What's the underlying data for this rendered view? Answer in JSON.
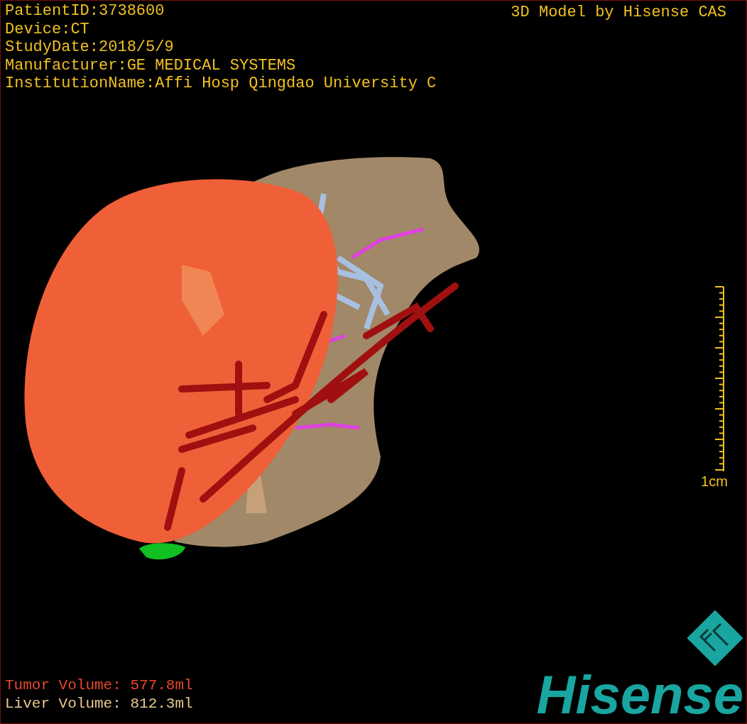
{
  "info_lines": [
    "PatientID:3738600",
    "Device:CT",
    "StudyDate:2018/5/9",
    "Manufacturer:GE MEDICAL SYSTEMS",
    "InstitutionName:Affi Hosp Qingdao University C"
  ],
  "title": "3D Model by Hisense CAS",
  "scale_bar": {
    "label": "1cm"
  },
  "volumes": [
    {
      "label": "Tumor Volume:",
      "value": "577.8ml",
      "color": "#e8482c"
    },
    {
      "label": "Liver Volume:",
      "value": "812.3ml",
      "color": "#e8c890"
    }
  ],
  "logo": {
    "text": "Hisense"
  }
}
